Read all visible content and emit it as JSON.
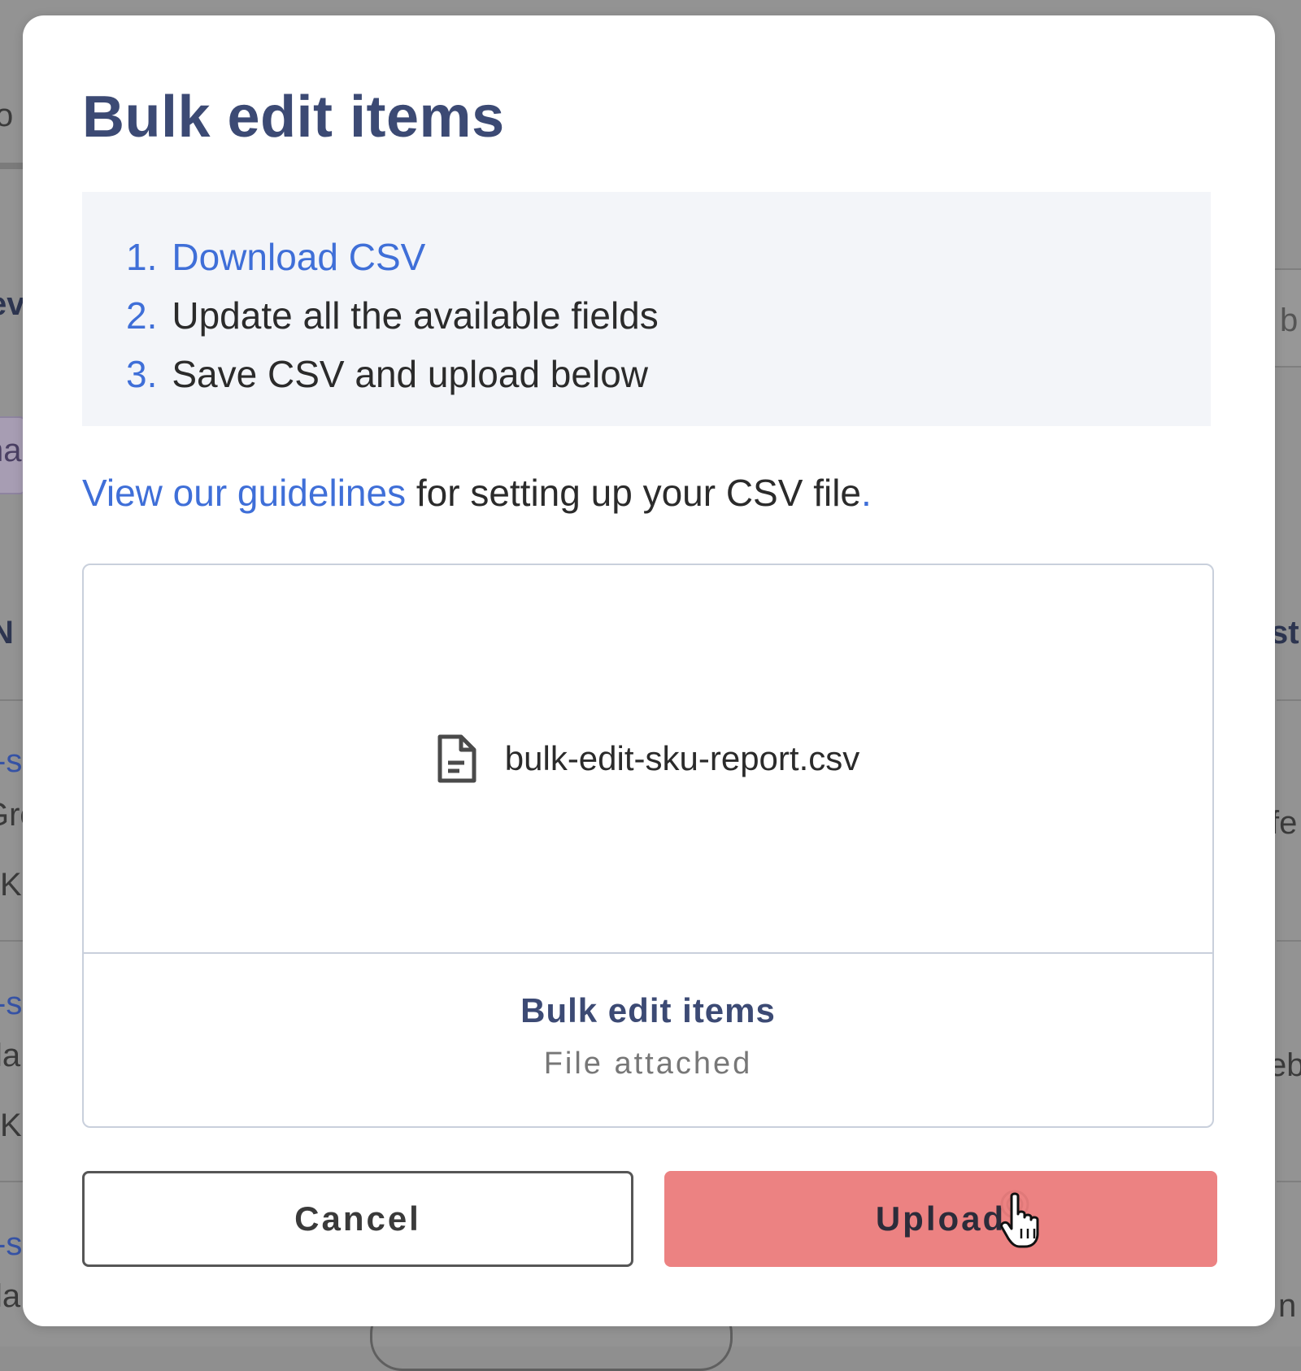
{
  "modal": {
    "title": "Bulk edit items",
    "steps": [
      {
        "number": "1.",
        "text": "Download CSV",
        "is_link": true
      },
      {
        "number": "2.",
        "text": "Update all the available fields",
        "is_link": false
      },
      {
        "number": "3.",
        "text": "Save CSV and upload below",
        "is_link": false
      }
    ],
    "guidelines": {
      "link_text": "View our guidelines",
      "rest_text": " for setting up your CSV file",
      "period": "."
    },
    "dropzone": {
      "file_icon": "document-icon",
      "file_name": "bulk-edit-sku-report.csv",
      "title": "Bulk edit items",
      "status": "File attached"
    },
    "buttons": {
      "cancel_label": "Cancel",
      "upload_label": "Upload"
    }
  },
  "colors": {
    "title": "#3c4a74",
    "link": "#3f6fd8",
    "upload_button": "#ec8282",
    "steps_background": "#f3f5f9",
    "overlay": "#939393"
  },
  "background_fragments": {
    "left": [
      "o",
      "ev",
      "na",
      "N",
      "-s",
      "Gre",
      "K",
      "-s",
      "la",
      "K",
      "-s",
      "la"
    ],
    "right": [
      "b",
      "st",
      "fe",
      "eb",
      "n"
    ]
  }
}
